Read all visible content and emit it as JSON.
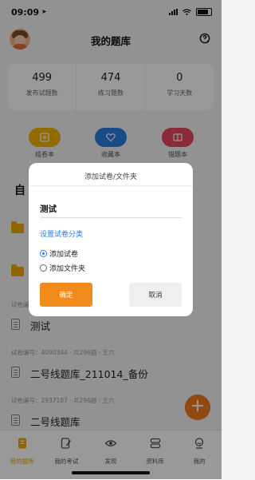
{
  "status_bar": {
    "time": "09:09"
  },
  "header": {
    "title": "我的题库"
  },
  "stats": [
    {
      "value": "499",
      "label": "发布试题数"
    },
    {
      "value": "474",
      "label": "练习题数"
    },
    {
      "value": "0",
      "label": "学习天数"
    }
  ],
  "quick_actions": [
    {
      "label": "组卷本",
      "color": "#f4b400"
    },
    {
      "label": "收藏本",
      "color": "#2a7de1"
    },
    {
      "label": "错题本",
      "color": "#e8485c"
    }
  ],
  "section": {
    "title": "自"
  },
  "paper_list": [
    {
      "meta": "",
      "title": "测试"
    },
    {
      "meta": "试卷编号：4090344 · 共296题 · 五六",
      "title": "二号线题库_211014_备份"
    },
    {
      "meta": "试卷编号：2937187 · 共296题 · 五六",
      "title": "二号线题库"
    }
  ],
  "list_meta_first": "试卷编号",
  "fab": {
    "label": "+"
  },
  "bottom_nav": [
    {
      "label": "我的题库",
      "icon": "book-icon",
      "active": true
    },
    {
      "label": "我的考试",
      "icon": "pencil-icon",
      "active": false
    },
    {
      "label": "发现",
      "icon": "eye-icon",
      "active": false
    },
    {
      "label": "资料库",
      "icon": "database-icon",
      "active": false
    },
    {
      "label": "我的",
      "icon": "profile-icon",
      "active": false
    }
  ],
  "dialog": {
    "title": "添加试卷/文件夹",
    "name_value": "测试",
    "category_link": "设置试卷分类",
    "options": [
      {
        "label": "添加试卷",
        "checked": true
      },
      {
        "label": "添加文件夹",
        "checked": false
      }
    ],
    "confirm_label": "确定",
    "cancel_label": "取消"
  },
  "colors": {
    "accent": "#f08b1c",
    "link": "#2a7de1",
    "active_nav": "#f4a400"
  }
}
